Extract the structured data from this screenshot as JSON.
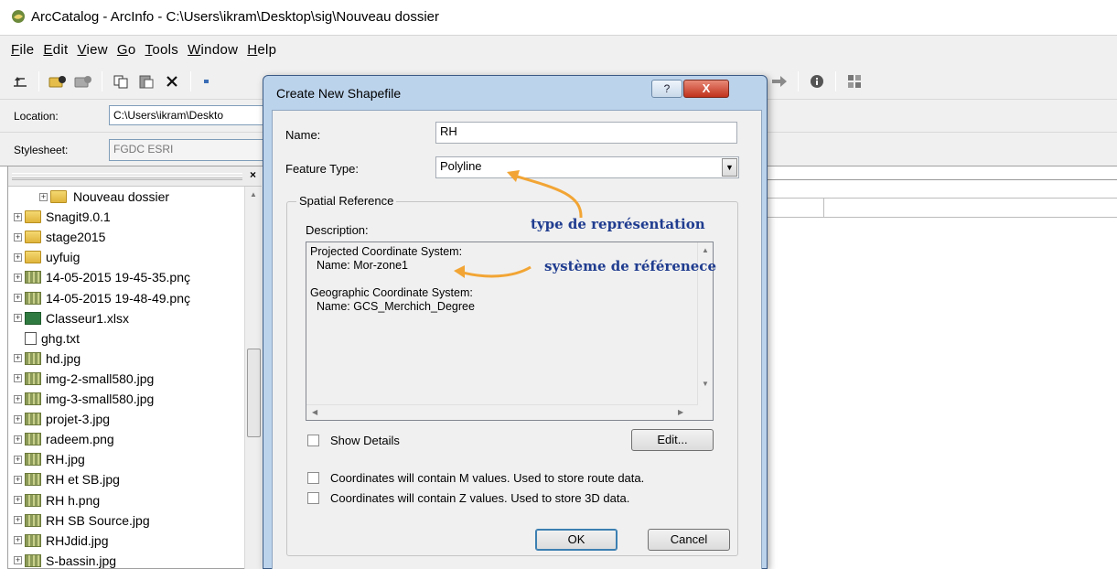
{
  "window": {
    "title": "ArcCatalog - ArcInfo - C:\\Users\\ikram\\Desktop\\sig\\Nouveau dossier"
  },
  "menu": {
    "items": [
      {
        "label": "File",
        "key": "F",
        "rest": "ile"
      },
      {
        "label": "Edit",
        "key": "E",
        "rest": "dit"
      },
      {
        "label": "View",
        "key": "V",
        "rest": "iew"
      },
      {
        "label": "Go",
        "key": "G",
        "rest": "o"
      },
      {
        "label": "Tools",
        "key": "T",
        "rest": "ools"
      },
      {
        "label": "Window",
        "key": "W",
        "rest": "indow"
      },
      {
        "label": "Help",
        "key": "H",
        "rest": "elp"
      }
    ]
  },
  "toolbar": {
    "icons": [
      "up-one-level-icon",
      "connect-folder-icon",
      "disconnect-folder-icon",
      "copy-icon",
      "paste-icon",
      "delete-icon",
      "forward-icon",
      "metadata-icon",
      "grid-icon"
    ]
  },
  "location": {
    "label": "Location:",
    "value": "C:\\Users\\ikram\\Deskto"
  },
  "stylesheet": {
    "label": "Stylesheet:",
    "value": "FGDC ESRI"
  },
  "tree": {
    "items": [
      {
        "label": "Nouveau dossier",
        "icon": "folder",
        "selected": true
      },
      {
        "label": "Snagit9.0.1",
        "icon": "folder"
      },
      {
        "label": "stage2015",
        "icon": "folder"
      },
      {
        "label": "uyfuig",
        "icon": "folder"
      },
      {
        "label": "14-05-2015 19-45-35.pnç",
        "icon": "image"
      },
      {
        "label": "14-05-2015 19-48-49.pnç",
        "icon": "image"
      },
      {
        "label": "Classeur1.xlsx",
        "icon": "spreadsheet"
      },
      {
        "label": "ghg.txt",
        "icon": "text"
      },
      {
        "label": "hd.jpg",
        "icon": "image"
      },
      {
        "label": "img-2-small580.jpg",
        "icon": "image"
      },
      {
        "label": "img-3-small580.jpg",
        "icon": "image"
      },
      {
        "label": "projet-3.jpg",
        "icon": "image"
      },
      {
        "label": "radeem.png",
        "icon": "image"
      },
      {
        "label": "RH.jpg",
        "icon": "image"
      },
      {
        "label": "RH et SB.jpg",
        "icon": "image"
      },
      {
        "label": "RH h.png",
        "icon": "image"
      },
      {
        "label": "RH SB Source.jpg",
        "icon": "image"
      },
      {
        "label": "RHJdid.jpg",
        "icon": "image"
      },
      {
        "label": "S-bassin.jpg",
        "icon": "image"
      }
    ]
  },
  "dialog": {
    "title": "Create New Shapefile",
    "help_label": "?",
    "close_label": "X",
    "name_label": "Name:",
    "name_value": "RH",
    "feature_type_label": "Feature Type:",
    "feature_type_value": "Polyline",
    "spatial_reference_label": "Spatial Reference",
    "description_label": "Description:",
    "description_lines": [
      "Projected Coordinate System:",
      "  Name: Mor-zone1",
      "",
      "Geographic Coordinate System:",
      "  Name: GCS_Merchich_Degree"
    ],
    "show_details_label": "Show Details",
    "show_details_checked": false,
    "edit_label": "Edit...",
    "m_values_label": "Coordinates will contain M values. Used to store route data.",
    "m_values_checked": false,
    "z_values_label": "Coordinates will contain Z values. Used to store 3D data.",
    "z_values_checked": false,
    "ok_label": "OK",
    "cancel_label": "Cancel"
  },
  "annotations": {
    "feature_type_note": "type de représentation",
    "spatial_ref_note": "système de référenece",
    "color": "#1f3c8f",
    "arrow_color": "#f2a534"
  }
}
